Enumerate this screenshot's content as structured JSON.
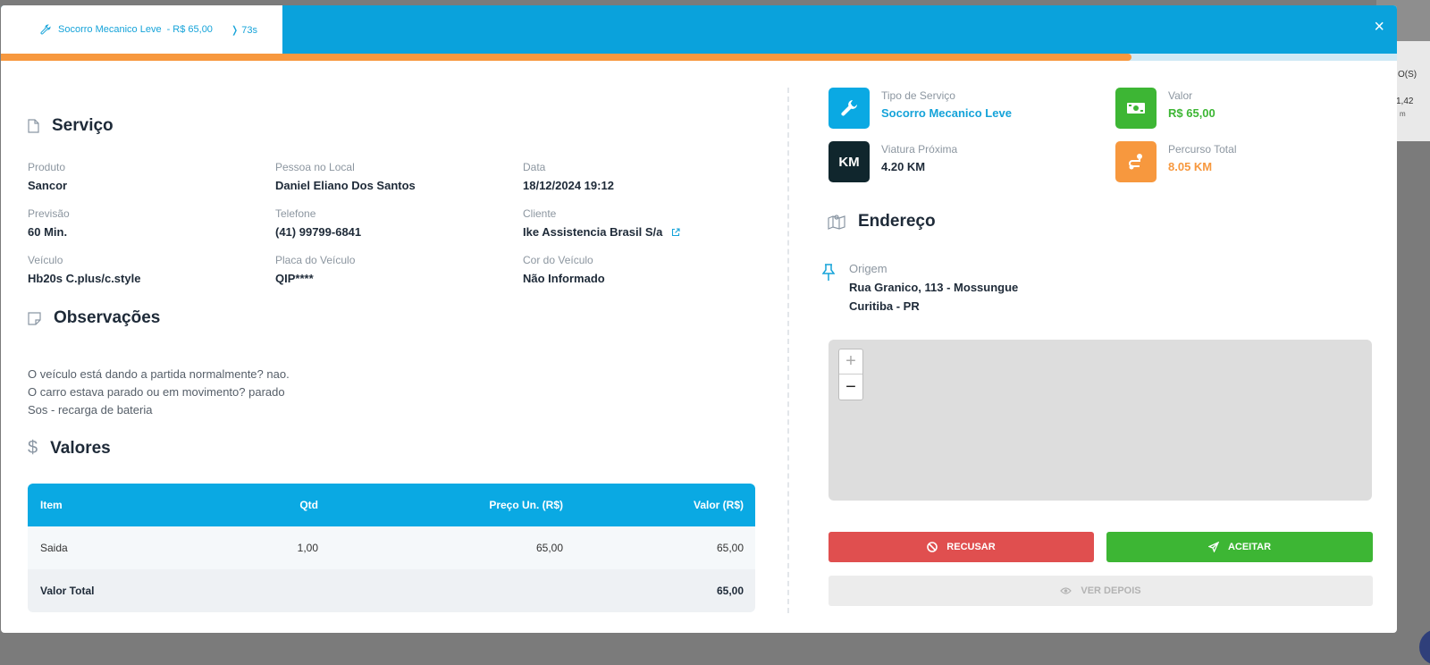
{
  "header": {
    "tab_service": "Socorro Mecanico Leve",
    "tab_price": "- R$ 65,00",
    "tab_timer": "73s",
    "progress_fraction": 0.81,
    "colors": {
      "header": "#0aa2dc",
      "progress": "#f7983e"
    }
  },
  "background": {
    "text1": "O(S)",
    "text2": "1,42",
    "text3": "m"
  },
  "servico": {
    "title": "Serviço",
    "fields": [
      {
        "label": "Produto",
        "value": "Sancor"
      },
      {
        "label": "Pessoa no Local",
        "value": "Daniel Eliano Dos Santos"
      },
      {
        "label": "Data",
        "value": "18/12/2024 19:12"
      },
      {
        "label": "Previsão",
        "value": "60 Min."
      },
      {
        "label": "Telefone",
        "value": "(41) 99799-6841"
      },
      {
        "label": "Cliente",
        "value": "Ike Assistencia Brasil S/a"
      },
      {
        "label": "Veículo",
        "value": "Hb20s C.plus/c.style"
      },
      {
        "label": "Placa do Veículo",
        "value": "QIP****"
      },
      {
        "label": "Cor do Veículo",
        "value": "Não Informado"
      }
    ]
  },
  "observacoes": {
    "title": "Observações",
    "lines": [
      "O veículo está dando a partida normalmente? nao.",
      "O carro estava parado ou em movimento? parado",
      "Sos - recarga de bateria"
    ]
  },
  "valores": {
    "title": "Valores",
    "columns": [
      "Item",
      "Qtd",
      "Preço Un. (R$)",
      "Valor (R$)"
    ],
    "rows": [
      {
        "item": "Saida",
        "qtd": "1,00",
        "preco": "65,00",
        "valor": "65,00"
      }
    ],
    "total_label": "Valor Total",
    "total_value": "65,00"
  },
  "stats": {
    "tipo": {
      "label": "Tipo de Serviço",
      "value": "Socorro Mecanico Leve",
      "color": "#15a3d9"
    },
    "valor": {
      "label": "Valor",
      "value": "R$ 65,00",
      "color": "#3db634"
    },
    "viatura": {
      "label": "Viatura Próxima",
      "value": "4.20 KM",
      "icon_text": "KM",
      "color": "#1e2a38"
    },
    "percurso": {
      "label": "Percurso Total",
      "value": "8.05 KM",
      "color": "#f7983e"
    }
  },
  "endereco": {
    "title": "Endereço",
    "origem_label": "Origem",
    "line1": "Rua Granico, 113 - Mossungue",
    "line2": "Curitiba - PR"
  },
  "map": {
    "zoom_in": "+",
    "zoom_out": "−"
  },
  "actions": {
    "recusar": "RECUSAR",
    "aceitar": "ACEITAR",
    "ver_depois": "VER DEPOIS"
  }
}
